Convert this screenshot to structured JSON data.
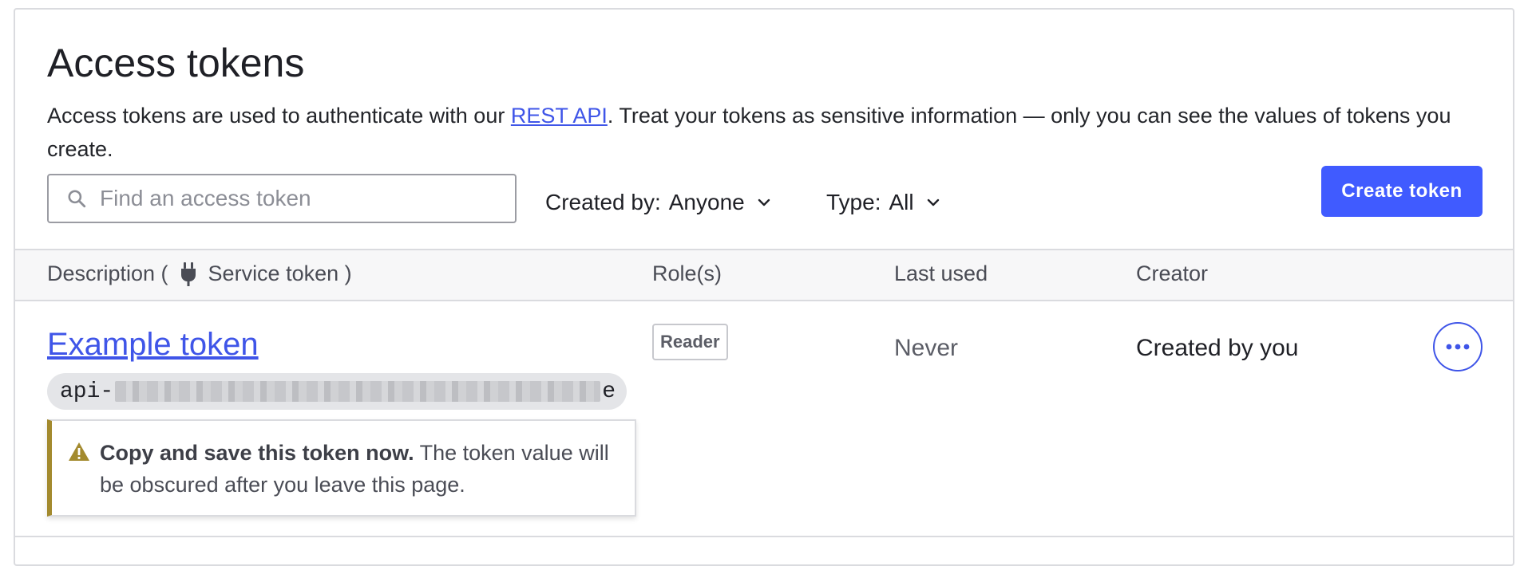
{
  "page": {
    "title": "Access tokens",
    "description_before_link": "Access tokens are used to authenticate with our ",
    "description_link": "REST API",
    "description_after_link": ". Treat your tokens as sensitive information — only you can see the values of tokens you create."
  },
  "toolbar": {
    "search_placeholder": "Find an access token",
    "search_value": "",
    "created_by_label": "Created by:",
    "created_by_value": "Anyone",
    "type_label": "Type:",
    "type_value": "All",
    "create_button": "Create token"
  },
  "table": {
    "columns": {
      "description_prefix": "Description (",
      "description_service": "Service token )",
      "roles": "Role(s)",
      "last_used": "Last used",
      "creator": "Creator"
    },
    "rows": [
      {
        "name": "Example token",
        "token_prefix": "api-",
        "token_suffix": "e",
        "role": "Reader",
        "last_used": "Never",
        "creator": "Created by you",
        "warning_bold": "Copy and save this token now.",
        "warning_text": " The token value will be obscured after you leave this page."
      }
    ]
  },
  "colors": {
    "accent": "#405bff",
    "link": "#3f55e8",
    "warning_border": "#a38a2e"
  },
  "icons": {
    "search": "search-icon",
    "chevron": "chevron-down-icon",
    "service": "plug-icon",
    "warning": "warning-icon",
    "more": "more-horizontal-icon"
  }
}
